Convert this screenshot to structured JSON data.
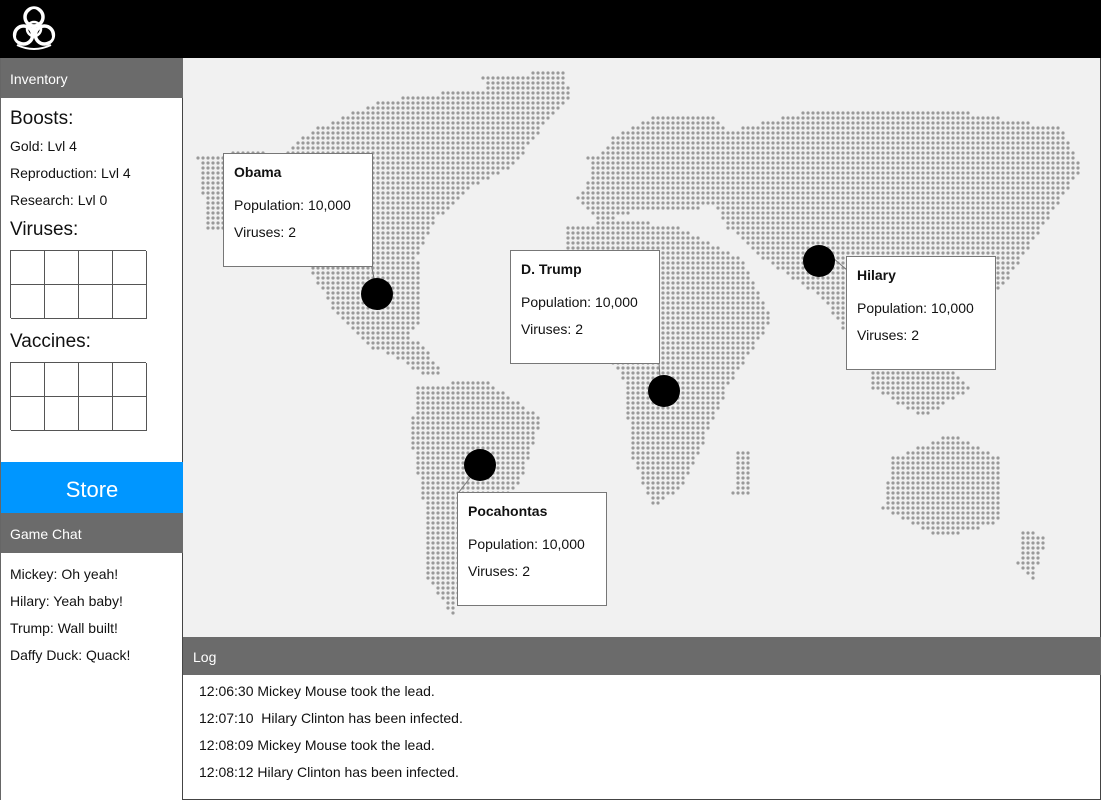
{
  "app": {
    "logo_icon": "biohazard-icon"
  },
  "inventory": {
    "header": "Inventory",
    "boosts_title": "Boosts:",
    "boosts": [
      "Gold: Lvl 4",
      "Reproduction: Lvl 4",
      "Research: Lvl 0"
    ],
    "viruses_title": "Viruses:",
    "vaccines_title": "Vaccines:"
  },
  "store": {
    "label": "Store",
    "color": "#0096ff"
  },
  "chat": {
    "header": "Game Chat",
    "messages": [
      "Mickey: Oh yeah!",
      "Hilary: Yeah baby!",
      "Trump: Wall built!",
      "Daffy Duck: Quack!"
    ]
  },
  "players": [
    {
      "name": "Obama",
      "population": "Population: 10,000",
      "viruses": "Viruses: 2"
    },
    {
      "name": "D. Trump",
      "population": "Population: 10,000",
      "viruses": "Viruses: 2"
    },
    {
      "name": "Hilary",
      "population": "Population: 10,000",
      "viruses": "Viruses: 2"
    },
    {
      "name": "Pocahontas",
      "population": "Population: 10,000",
      "viruses": "Viruses: 2"
    }
  ],
  "log": {
    "header": "Log",
    "entries": [
      "12:06:30 Mickey Mouse took the lead.",
      "12:07:10  Hilary Clinton has been infected.",
      "12:08:09 Mickey Mouse took the lead.",
      "12:08:12 Hilary Clinton has been infected."
    ]
  },
  "colors": {
    "header_gray": "#6b6b6b",
    "map_bg": "#f1f1f1",
    "dot": "#9a9a9a"
  }
}
